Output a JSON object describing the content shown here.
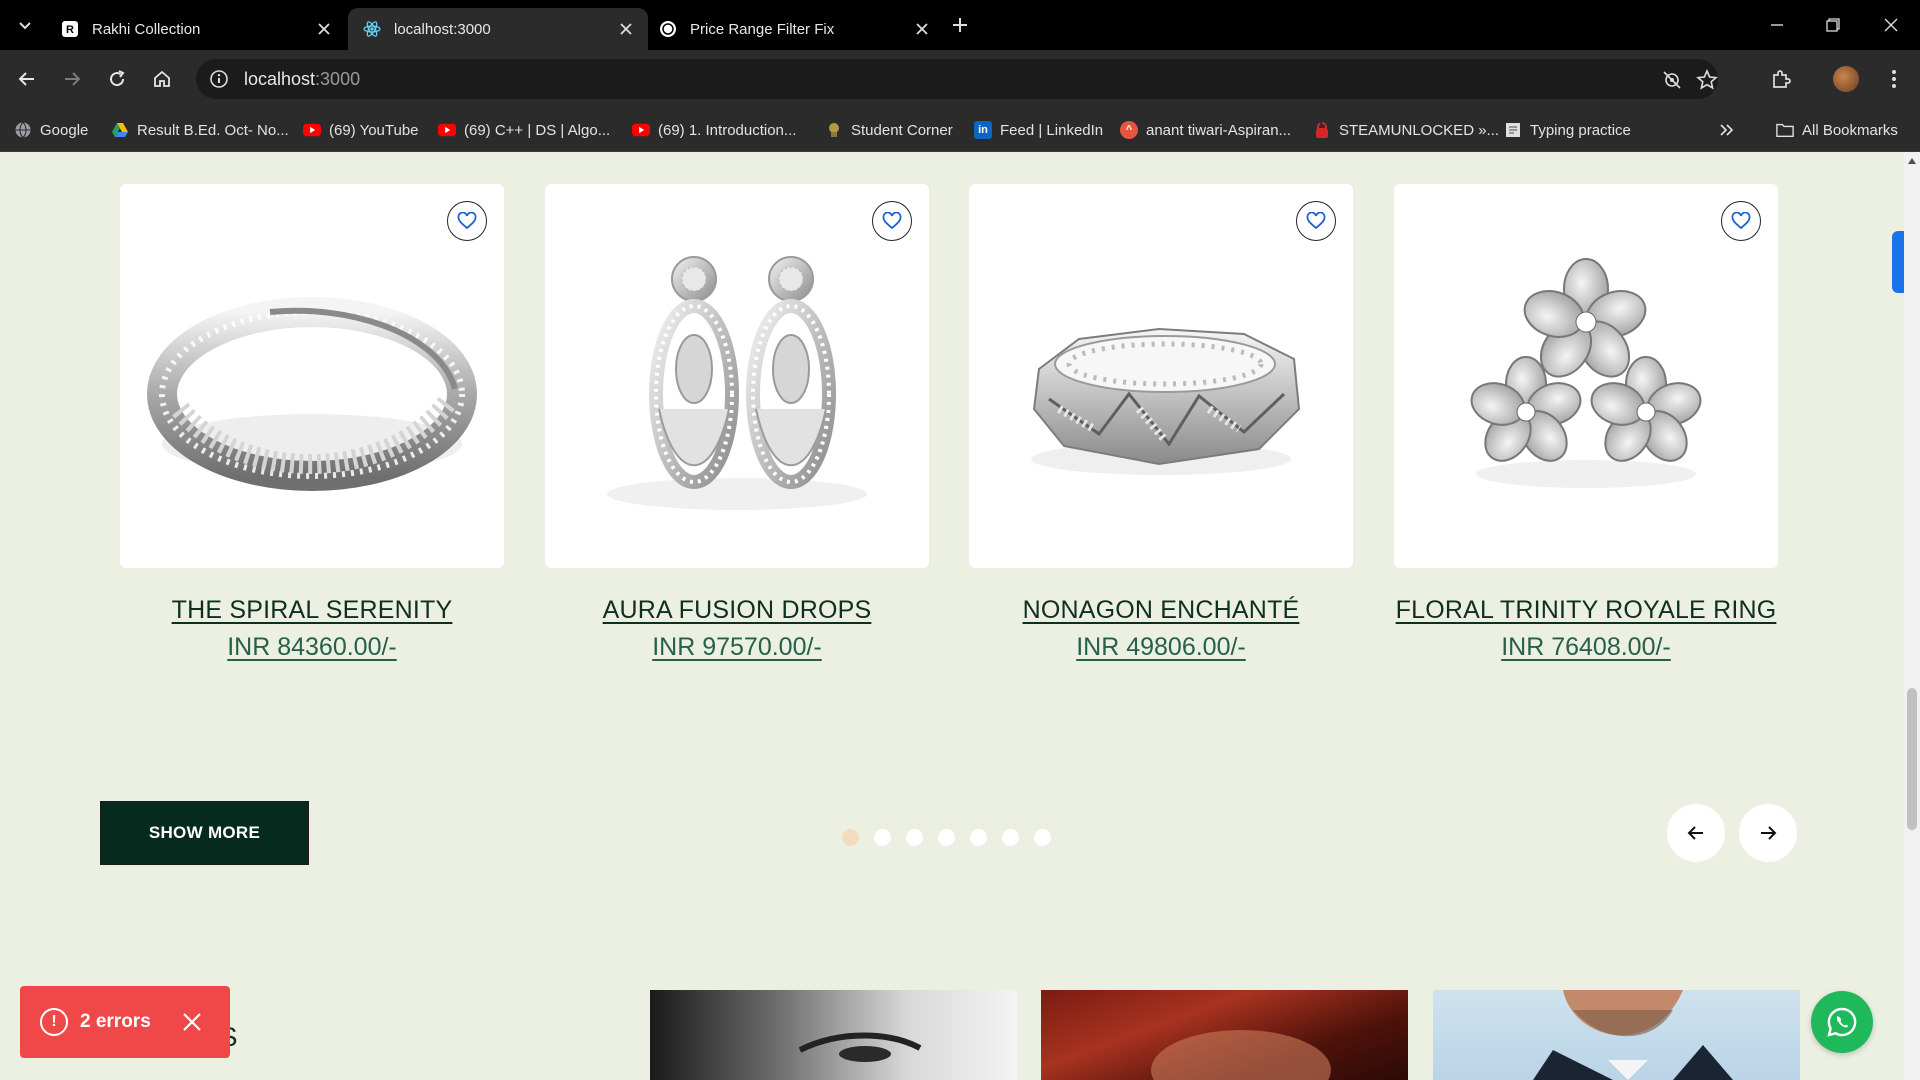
{
  "browser": {
    "tabs": [
      {
        "title": "Rakhi Collection",
        "icon": "site-logo-icon",
        "active": false
      },
      {
        "title": "localhost:3000",
        "icon": "react-icon",
        "active": true
      },
      {
        "title": "Price Range Filter Fix",
        "icon": "chatgpt-icon",
        "active": false
      }
    ],
    "url_host": "localhost",
    "url_port": ":3000",
    "bookmarks": [
      {
        "label": "Google",
        "icon": "globe-icon",
        "color": "#5f6368"
      },
      {
        "label": "Result B.Ed. Oct- No...",
        "icon": "drive-icon",
        "color": "#1fa463"
      },
      {
        "label": "(69) YouTube",
        "icon": "youtube-icon",
        "color": "#ff0000"
      },
      {
        "label": "(69) C++ | DS | Algo...",
        "icon": "youtube-icon",
        "color": "#ff0000"
      },
      {
        "label": "(69) 1. Introduction...",
        "icon": "youtube-icon",
        "color": "#ff0000"
      },
      {
        "label": "Student Corner",
        "icon": "emblem-icon",
        "color": "#8a7a3b"
      },
      {
        "label": "Feed | LinkedIn",
        "icon": "linkedin-icon",
        "color": "#0a66c2"
      },
      {
        "label": "anant tiwari-Aspiran...",
        "icon": "unstop-icon",
        "color": "#e8553e"
      },
      {
        "label": "STEAMUNLOCKED »...",
        "icon": "steam-icon",
        "color": "#d6262b"
      },
      {
        "label": "Typing practice",
        "icon": "document-icon",
        "color": "#d8d8d8"
      }
    ],
    "all_bookmarks": "All Bookmarks"
  },
  "products": [
    {
      "name": "THE SPIRAL SERENITY",
      "price": "INR 84360.00/-",
      "image": "spiral-ring"
    },
    {
      "name": "AURA FUSION DROPS",
      "price": "INR 97570.00/-",
      "image": "drop-earrings"
    },
    {
      "name": "NONAGON ENCHANTÉ",
      "price": "INR 49806.00/-",
      "image": "nonagon-band"
    },
    {
      "name": "FLORAL TRINITY ROYALE RING",
      "price": "INR 76408.00/-",
      "image": "floral-ring"
    }
  ],
  "carousel": {
    "dot_count": 7,
    "active_dot": 0,
    "active_color": "#f5dcc0"
  },
  "show_more_label": "SHOW MORE",
  "bottom_section_title_visible": "NS",
  "errors": {
    "label": "2 errors",
    "color": "#f04848"
  },
  "colors": {
    "page_bg": "#ecf0e2",
    "primary_dark": "#062b1e",
    "whatsapp": "#1fb85a"
  }
}
